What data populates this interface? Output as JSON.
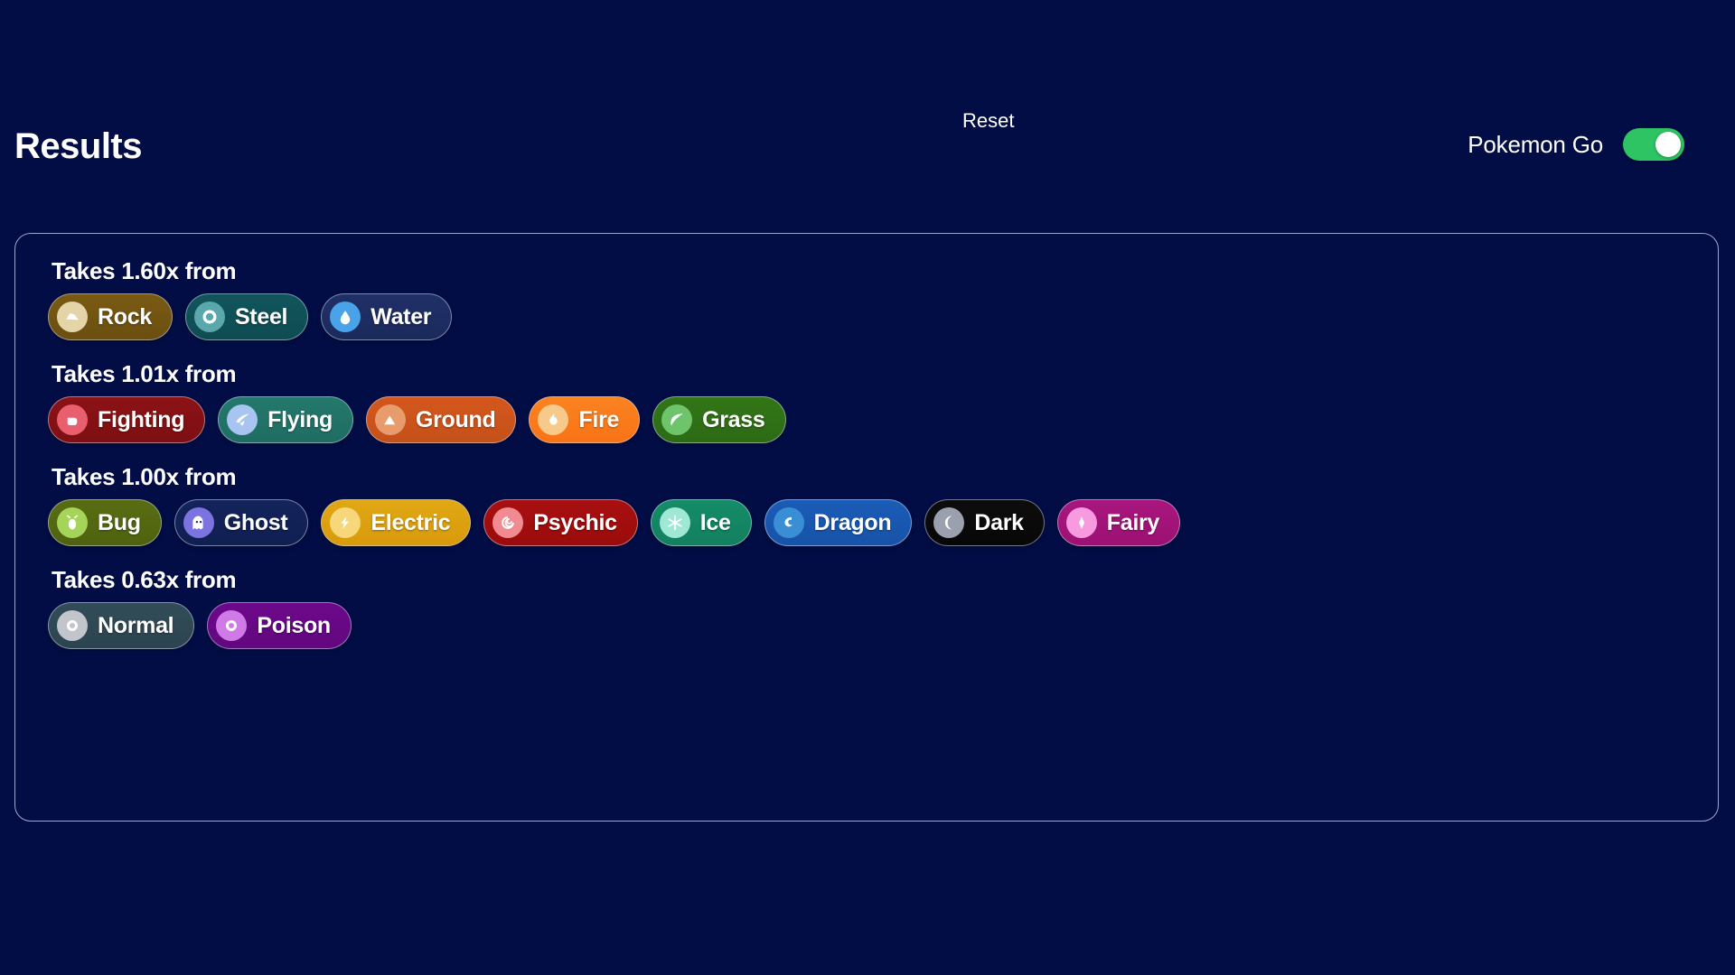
{
  "header": {
    "title": "Results",
    "reset_label": "Reset",
    "toggle_label": "Pokemon Go",
    "toggle_state": "on",
    "toggle_on_color": "#2ec363"
  },
  "theme": {
    "page_background": "#020d45",
    "panel_border": "#d2dcff",
    "text": "#ffffff"
  },
  "results": {
    "groups": [
      {
        "title": "Takes 1.60x from",
        "multiplier": "1.60x",
        "types": [
          {
            "name": "Rock",
            "icon": "rock-icon",
            "chip_color": "#6b4f11",
            "chip_color_end": "#7a5a12",
            "icon_bg": "#e4d5a8",
            "icon_fg": "#ffffff"
          },
          {
            "name": "Steel",
            "icon": "steel-icon",
            "chip_color": "#0f4c52",
            "chip_color_end": "#11555c",
            "icon_bg": "#5aa8ab",
            "icon_fg": "#ffffff"
          },
          {
            "name": "Water",
            "icon": "water-icon",
            "chip_color": "#1b2a5c",
            "chip_color_end": "#1f3068",
            "icon_bg": "#4aa3e8",
            "icon_fg": "#ffffff"
          }
        ]
      },
      {
        "title": "Takes 1.01x from",
        "multiplier": "1.01x",
        "types": [
          {
            "name": "Fighting",
            "icon": "fighting-icon",
            "chip_color": "#7d0f12",
            "chip_color_end": "#8c1216",
            "icon_bg": "#e8606e",
            "icon_fg": "#ffffff"
          },
          {
            "name": "Flying",
            "icon": "flying-icon",
            "chip_color": "#1f6d62",
            "chip_color_end": "#24786c",
            "icon_bg": "#a8c4f0",
            "icon_fg": "#ffffff"
          },
          {
            "name": "Ground",
            "icon": "ground-icon",
            "chip_color": "#c4511a",
            "chip_color_end": "#d4571c",
            "icon_bg": "#e89c6e",
            "icon_fg": "#ffffff"
          },
          {
            "name": "Fire",
            "icon": "fire-icon",
            "chip_color": "#f97316",
            "chip_color_end": "#fb8321",
            "icon_bg": "#f7c98a",
            "icon_fg": "#ffffff"
          },
          {
            "name": "Grass",
            "icon": "grass-icon",
            "chip_color": "#2d6a15",
            "chip_color_end": "#327617",
            "icon_bg": "#6dc46a",
            "icon_fg": "#ffffff"
          }
        ]
      },
      {
        "title": "Takes 1.00x from",
        "multiplier": "1.00x",
        "types": [
          {
            "name": "Bug",
            "icon": "bug-icon",
            "chip_color": "#4f6210",
            "chip_color_end": "#586d12",
            "icon_bg": "#a5d45a",
            "icon_fg": "#ffffff"
          },
          {
            "name": "Ghost",
            "icon": "ghost-icon",
            "chip_color": "#101f52",
            "chip_color_end": "#13245c",
            "icon_bg": "#7b74e0",
            "icon_fg": "#ffffff"
          },
          {
            "name": "Electric",
            "icon": "electric-icon",
            "chip_color": "#d99a0b",
            "chip_color_end": "#e0a814",
            "icon_bg": "#f6d77a",
            "icon_fg": "#ffffff"
          },
          {
            "name": "Psychic",
            "icon": "psychic-icon",
            "chip_color": "#9b0b0b",
            "chip_color_end": "#a81010",
            "icon_bg": "#f08b92",
            "icon_fg": "#ffffff"
          },
          {
            "name": "Ice",
            "icon": "ice-icon",
            "chip_color": "#12805f",
            "chip_color_end": "#158c68",
            "icon_bg": "#9fe8d4",
            "icon_fg": "#ffffff"
          },
          {
            "name": "Dragon",
            "icon": "dragon-icon",
            "chip_color": "#1753a8",
            "chip_color_end": "#1a5cb8",
            "icon_bg": "#3a8fd4",
            "icon_fg": "#ffffff"
          },
          {
            "name": "Dark",
            "icon": "dark-icon",
            "chip_color": "#070707",
            "chip_color_end": "#0d0d0d",
            "icon_bg": "#9aa0ad",
            "icon_fg": "#ffffff"
          },
          {
            "name": "Fairy",
            "icon": "fairy-icon",
            "chip_color": "#9c1173",
            "chip_color_end": "#a8167d",
            "icon_bg": "#f79ae0",
            "icon_fg": "#ffffff"
          }
        ]
      },
      {
        "title": "Takes 0.63x from",
        "multiplier": "0.63x",
        "types": [
          {
            "name": "Normal",
            "icon": "normal-icon",
            "chip_color": "#2c4450",
            "chip_color_end": "#314c58",
            "icon_bg": "#c2c6cc",
            "icon_fg": "#ffffff"
          },
          {
            "name": "Poison",
            "icon": "poison-icon",
            "chip_color": "#62077e",
            "chip_color_end": "#6d098b",
            "icon_bg": "#d07ae8",
            "icon_fg": "#ffffff"
          }
        ]
      }
    ]
  }
}
